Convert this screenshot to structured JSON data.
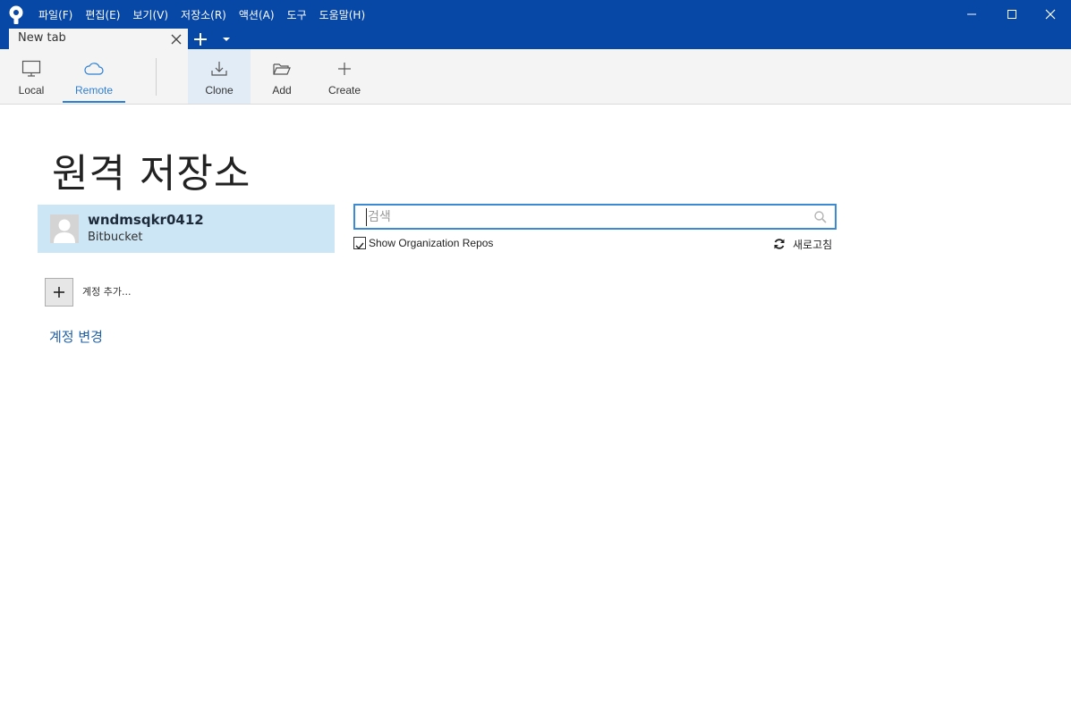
{
  "menu": [
    "파일(F)",
    "편집(E)",
    "보기(V)",
    "저장소(R)",
    "액션(A)",
    "도구",
    "도움말(H)"
  ],
  "tab": {
    "title": "New tab"
  },
  "toolbar": {
    "local": "Local",
    "remote": "Remote",
    "clone": "Clone",
    "add": "Add",
    "create": "Create"
  },
  "page": {
    "title": "원격 저장소"
  },
  "account": {
    "name": "wndmsqkr0412",
    "service": "Bitbucket"
  },
  "add_account": {
    "label": "계정 추가..."
  },
  "change_account": {
    "label": "계정 변경"
  },
  "search": {
    "placeholder": "검색",
    "value": ""
  },
  "options": {
    "show_org_repos": "Show Organization Repos",
    "show_org_repos_checked": true
  },
  "refresh": {
    "label": "새로고침"
  },
  "colors": {
    "titlebar": "#0747a6",
    "accent": "#2e7fd1",
    "selected_card": "#cde6f6",
    "link": "#1f5fa6"
  }
}
